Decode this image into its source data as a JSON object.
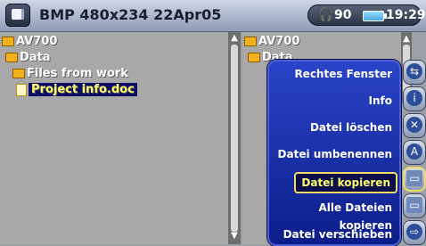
{
  "topbar": {
    "title": "BMP 480x234 22Apr05",
    "headphone_volume": "90",
    "time": "19:29"
  },
  "left_pane": {
    "items": [
      {
        "label": "AV700",
        "type": "folder"
      },
      {
        "label": "Data",
        "type": "folder"
      },
      {
        "label": "Files from work",
        "type": "folder"
      },
      {
        "label": "Project info.doc",
        "type": "file",
        "selected": true
      }
    ]
  },
  "right_pane": {
    "items": [
      {
        "label": "AV700",
        "type": "folder"
      },
      {
        "label": "Data",
        "type": "folder"
      }
    ]
  },
  "menu": {
    "items": [
      "Rechtes Fenster",
      "Info",
      "Datei löschen",
      "Datei umbenennen",
      "Datei kopieren",
      "Alle Dateien kopieren",
      "Datei verschieben"
    ],
    "selected_index": 4
  },
  "icons": {
    "names": [
      "split-view-icon",
      "info-icon",
      "delete-icon",
      "rename-icon",
      "copy-file-icon",
      "copy-all-icon",
      "move-icon"
    ]
  },
  "colors": {
    "menu_bg": "#1730b5",
    "selection": "#0b0e64",
    "highlight_text": "#fffe6a",
    "folder": "#f3b21b"
  }
}
